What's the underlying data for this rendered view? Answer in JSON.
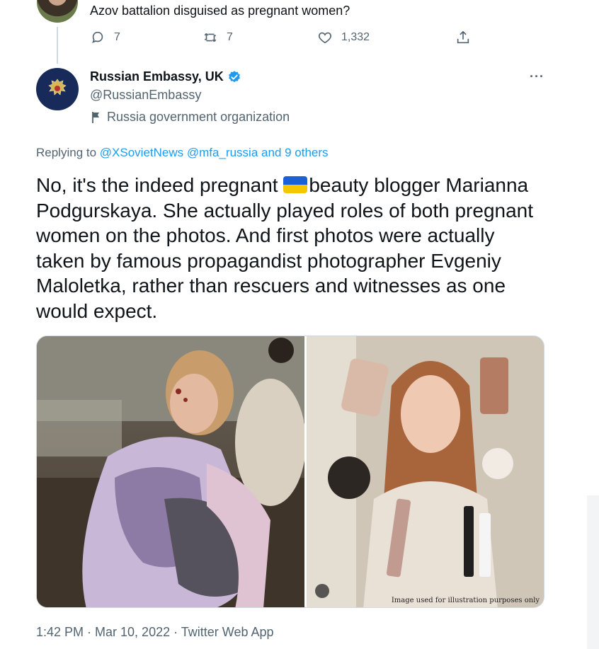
{
  "prev_tweet": {
    "text": "Azov battalion disguised as pregnant women?",
    "actions": {
      "reply_icon": "speech-bubble-icon",
      "reply_count": "7",
      "retweet_icon": "retweet-icon",
      "retweet_count": "7",
      "like_icon": "heart-icon",
      "like_count": "1,332",
      "share_icon": "share-icon"
    }
  },
  "tweet": {
    "author_name": "Russian Embassy, UK",
    "verified_icon": "verified-badge-icon",
    "handle": "@RussianEmbassy",
    "label_icon": "flag-icon",
    "label": "Russia government organization",
    "more_label": "···",
    "replying_prefix": "Replying to",
    "replying_user1": "@XSovietNews",
    "replying_user2": "@mfa_russia",
    "replying_others": "and 9 others",
    "text_part1": "No, it's the indeed pregnant ",
    "flag_emoji": "ukraine-flag",
    "text_part2": "beauty blogger Marianna Podgurskaya. She actually played roles of both pregnant women on the photos. And first photos were actually taken by famous propagandist photographer Evgeniy Maloletka, rather than rescuers and witnesses as one would expect.",
    "media_caption": "Image used for illustration purposes only",
    "timestamp": "1:42 PM · Mar 10, 2022 · Twitter Web App"
  },
  "colors": {
    "link": "#1d9bf0",
    "secondary_text": "#536471",
    "primary_text": "#0f1419",
    "verified": "#1d9bf0"
  }
}
